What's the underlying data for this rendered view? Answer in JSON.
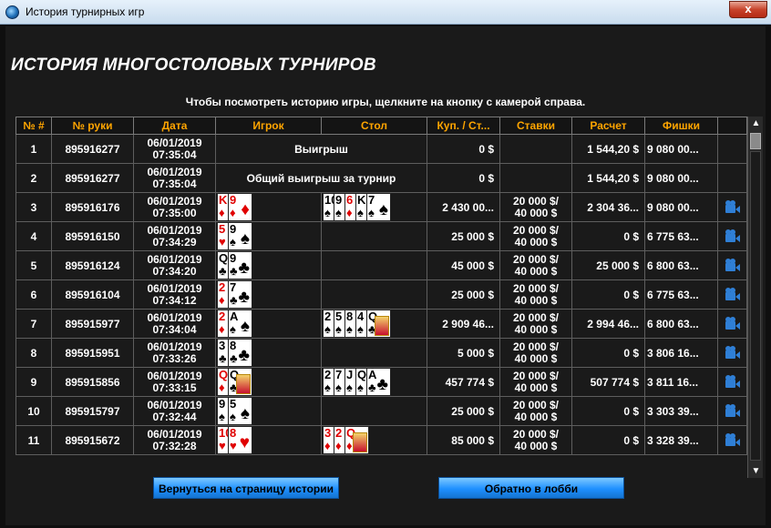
{
  "window": {
    "title": "История турнирных игр",
    "close_label": "x"
  },
  "heading": "ИСТОРИЯ МНОГОСТОЛОВЫХ ТУРНИРОВ",
  "hint": "Чтобы посмотреть историю игры, щелкните на  кнопку с камерой справа.",
  "columns": [
    "№ #",
    "№ руки",
    "Дата",
    "Игрок",
    "Стол",
    "Куп. / Ст...",
    "Ставки",
    "Расчет",
    "Фишки"
  ],
  "rows": [
    {
      "n": "1",
      "hand": "895916277",
      "date": "06/01/2019",
      "time": "07:35:04",
      "merged": "Выигрыш",
      "buyin": "0 $",
      "bets1": "",
      "bets2": "",
      "calc": "1 544,20 $",
      "chips": "9 080 00...",
      "cam": false
    },
    {
      "n": "2",
      "hand": "895916277",
      "date": "06/01/2019",
      "time": "07:35:04",
      "merged": "Общий выигрыш за турнир",
      "buyin": "0 $",
      "bets1": "",
      "bets2": "",
      "calc": "1 544,20 $",
      "chips": "9 080 00...",
      "cam": false
    },
    {
      "n": "3",
      "hand": "895916176",
      "date": "06/01/2019",
      "time": "07:35:00",
      "player": [
        {
          "r": "K",
          "s": "♦",
          "c": "red"
        },
        {
          "r": "9",
          "s": "♦",
          "c": "red"
        }
      ],
      "table": [
        {
          "r": "10",
          "s": "♠",
          "c": "blk"
        },
        {
          "r": "9",
          "s": "♠",
          "c": "blk"
        },
        {
          "r": "6",
          "s": "♦",
          "c": "red"
        },
        {
          "r": "K",
          "s": "♠",
          "c": "blk"
        },
        {
          "r": "7",
          "s": "♠",
          "c": "blk"
        }
      ],
      "buyin": "2 430 00...",
      "bets1": "20 000 $/",
      "bets2": "40 000 $",
      "calc": "2 304 36...",
      "chips": "9 080 00...",
      "cam": true
    },
    {
      "n": "4",
      "hand": "895916150",
      "date": "06/01/2019",
      "time": "07:34:29",
      "player": [
        {
          "r": "5",
          "s": "♥",
          "c": "red"
        },
        {
          "r": "9",
          "s": "♠",
          "c": "blk"
        }
      ],
      "table": [],
      "buyin": "25 000 $",
      "bets1": "20 000 $/",
      "bets2": "40 000 $",
      "calc": "0 $",
      "chips": "6 775 63...",
      "cam": true
    },
    {
      "n": "5",
      "hand": "895916124",
      "date": "06/01/2019",
      "time": "07:34:20",
      "player": [
        {
          "r": "Q",
          "s": "♣",
          "c": "blk"
        },
        {
          "r": "9",
          "s": "♣",
          "c": "blk"
        }
      ],
      "table": [],
      "buyin": "45 000 $",
      "bets1": "20 000 $/",
      "bets2": "40 000 $",
      "calc": "25 000 $",
      "chips": "6 800 63...",
      "cam": true
    },
    {
      "n": "6",
      "hand": "895916104",
      "date": "06/01/2019",
      "time": "07:34:12",
      "player": [
        {
          "r": "2",
          "s": "♦",
          "c": "red"
        },
        {
          "r": "7",
          "s": "♣",
          "c": "blk"
        }
      ],
      "table": [],
      "buyin": "25 000 $",
      "bets1": "20 000 $/",
      "bets2": "40 000 $",
      "calc": "0 $",
      "chips": "6 775 63...",
      "cam": true
    },
    {
      "n": "7",
      "hand": "895915977",
      "date": "06/01/2019",
      "time": "07:34:04",
      "player": [
        {
          "r": "2",
          "s": "♦",
          "c": "red"
        },
        {
          "r": "A",
          "s": "♠",
          "c": "blk"
        }
      ],
      "table": [
        {
          "r": "2",
          "s": "♠",
          "c": "blk"
        },
        {
          "r": "5",
          "s": "♠",
          "c": "blk"
        },
        {
          "r": "8",
          "s": "♠",
          "c": "blk"
        },
        {
          "r": "4",
          "s": "♠",
          "c": "blk"
        },
        {
          "r": "Q",
          "s": "♣",
          "c": "blk"
        }
      ],
      "buyin": "2 909 46...",
      "bets1": "20 000 $/",
      "bets2": "40 000 $",
      "calc": "2 994 46...",
      "chips": "6 800 63...",
      "cam": true
    },
    {
      "n": "8",
      "hand": "895915951",
      "date": "06/01/2019",
      "time": "07:33:26",
      "player": [
        {
          "r": "3",
          "s": "♣",
          "c": "blk"
        },
        {
          "r": "8",
          "s": "♣",
          "c": "blk"
        }
      ],
      "table": [],
      "buyin": "5 000 $",
      "bets1": "20 000 $/",
      "bets2": "40 000 $",
      "calc": "0 $",
      "chips": "3 806 16...",
      "cam": true
    },
    {
      "n": "9",
      "hand": "895915856",
      "date": "06/01/2019",
      "time": "07:33:15",
      "player": [
        {
          "r": "Q",
          "s": "♦",
          "c": "red"
        },
        {
          "r": "Q",
          "s": "♣",
          "c": "blk"
        }
      ],
      "table": [
        {
          "r": "2",
          "s": "♠",
          "c": "blk"
        },
        {
          "r": "7",
          "s": "♠",
          "c": "blk"
        },
        {
          "r": "J",
          "s": "♠",
          "c": "blk"
        },
        {
          "r": "Q",
          "s": "♠",
          "c": "blk"
        },
        {
          "r": "A",
          "s": "♣",
          "c": "blk"
        }
      ],
      "buyin": "457 774 $",
      "bets1": "20 000 $/",
      "bets2": "40 000 $",
      "calc": "507 774 $",
      "chips": "3 811 16...",
      "cam": true
    },
    {
      "n": "10",
      "hand": "895915797",
      "date": "06/01/2019",
      "time": "07:32:44",
      "player": [
        {
          "r": "9",
          "s": "♠",
          "c": "blk"
        },
        {
          "r": "5",
          "s": "♠",
          "c": "blk"
        }
      ],
      "table": [],
      "buyin": "25 000 $",
      "bets1": "20 000 $/",
      "bets2": "40 000 $",
      "calc": "0 $",
      "chips": "3 303 39...",
      "cam": true
    },
    {
      "n": "11",
      "hand": "895915672",
      "date": "06/01/2019",
      "time": "07:32:28",
      "player": [
        {
          "r": "10",
          "s": "♥",
          "c": "red"
        },
        {
          "r": "8",
          "s": "♥",
          "c": "red"
        }
      ],
      "table": [
        {
          "r": "3",
          "s": "♦",
          "c": "red"
        },
        {
          "r": "2",
          "s": "♦",
          "c": "red"
        },
        {
          "r": "Q",
          "s": "♦",
          "c": "red"
        }
      ],
      "buyin": "85 000 $",
      "bets1": "20 000 $/",
      "bets2": "40 000 $",
      "calc": "0 $",
      "chips": "3 328 39...",
      "cam": true
    }
  ],
  "buttons": {
    "back_history": "Вернуться на страницу истории",
    "back_lobby": "Обратно в лобби"
  },
  "colors": {
    "header_text": "#ffa500",
    "button": "#1e90ff",
    "camera": "#2f7fd6"
  },
  "icons": {
    "camera": "camera-icon",
    "window": "app-icon"
  }
}
